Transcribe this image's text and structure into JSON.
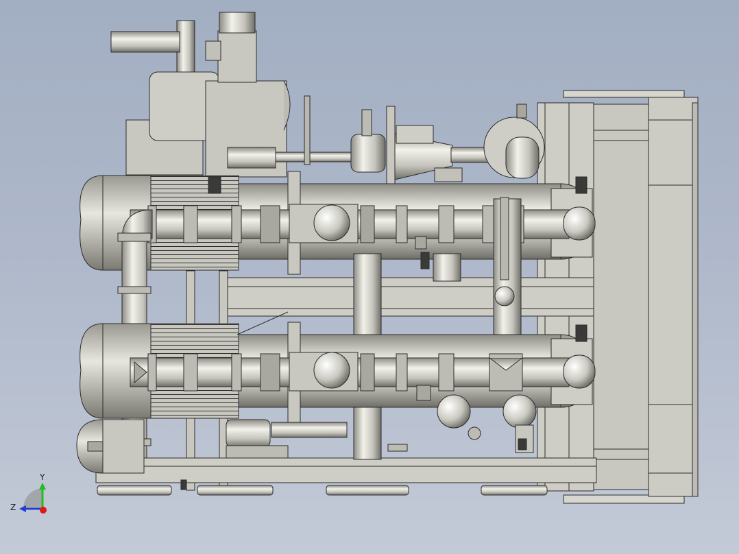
{
  "triad": {
    "axis_y": "Y",
    "axis_z": "Z",
    "y_color": "#1fbf1f",
    "z_color": "#1f3fd0",
    "x_color": "#e01818"
  },
  "model": {
    "body_color": "#c9c8c0",
    "edge_color": "#2b2b2b",
    "background_top": "#a2aec2",
    "background_bottom": "#c3cad7"
  }
}
